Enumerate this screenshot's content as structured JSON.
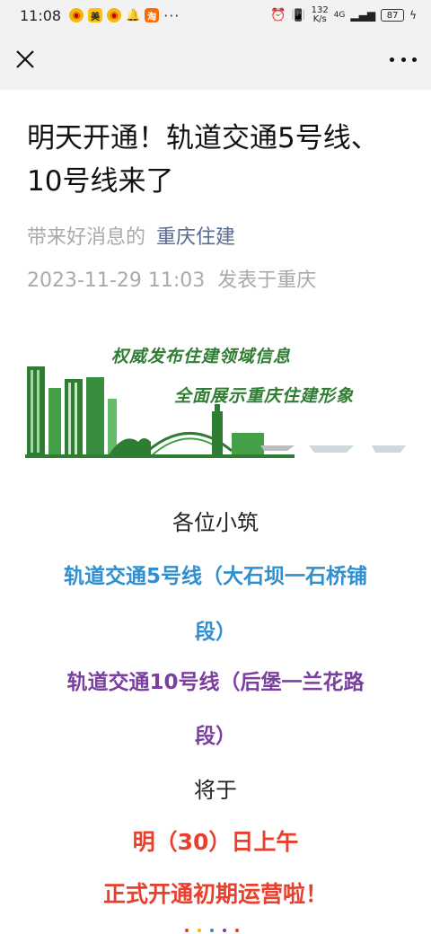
{
  "status_bar": {
    "time": "11:08",
    "app_icons": [
      "weibo-icon",
      "meituan-icon",
      "weibo-icon",
      "qq-icon",
      "taobao-icon"
    ],
    "meituan_label": "美",
    "more": "···",
    "net_speed_value": "132",
    "net_speed_unit": "K/s",
    "signal": "4G",
    "battery": "87"
  },
  "nav": {
    "close": "close-icon",
    "more": "more-icon"
  },
  "article": {
    "title": "明天开通！轨道交通5号线、10号线来了",
    "intro": "带来好消息的",
    "account": "重庆住建",
    "date": "2023-11-29 11:03",
    "location": "发表于重庆"
  },
  "banner": {
    "slogan1": "权威发布住建领域信息",
    "slogan2": "全面展示重庆住建形象",
    "accent_color": "#2e7d32"
  },
  "body": {
    "greeting": "各位小筑",
    "line5_a": "轨道交通5号线（大石坝一石桥铺",
    "line5_b": "段）",
    "line10_a": "轨道交通10号线（后堡一兰花路",
    "line10_b": "段）",
    "will": "将于",
    "when": "明（30）日上午",
    "open": "正式开通初期运营啦！"
  },
  "colors": {
    "line5": "#2f8fd0",
    "line10": "#7b3fa0",
    "highlight": "#e8402c",
    "account": "#576b95"
  }
}
